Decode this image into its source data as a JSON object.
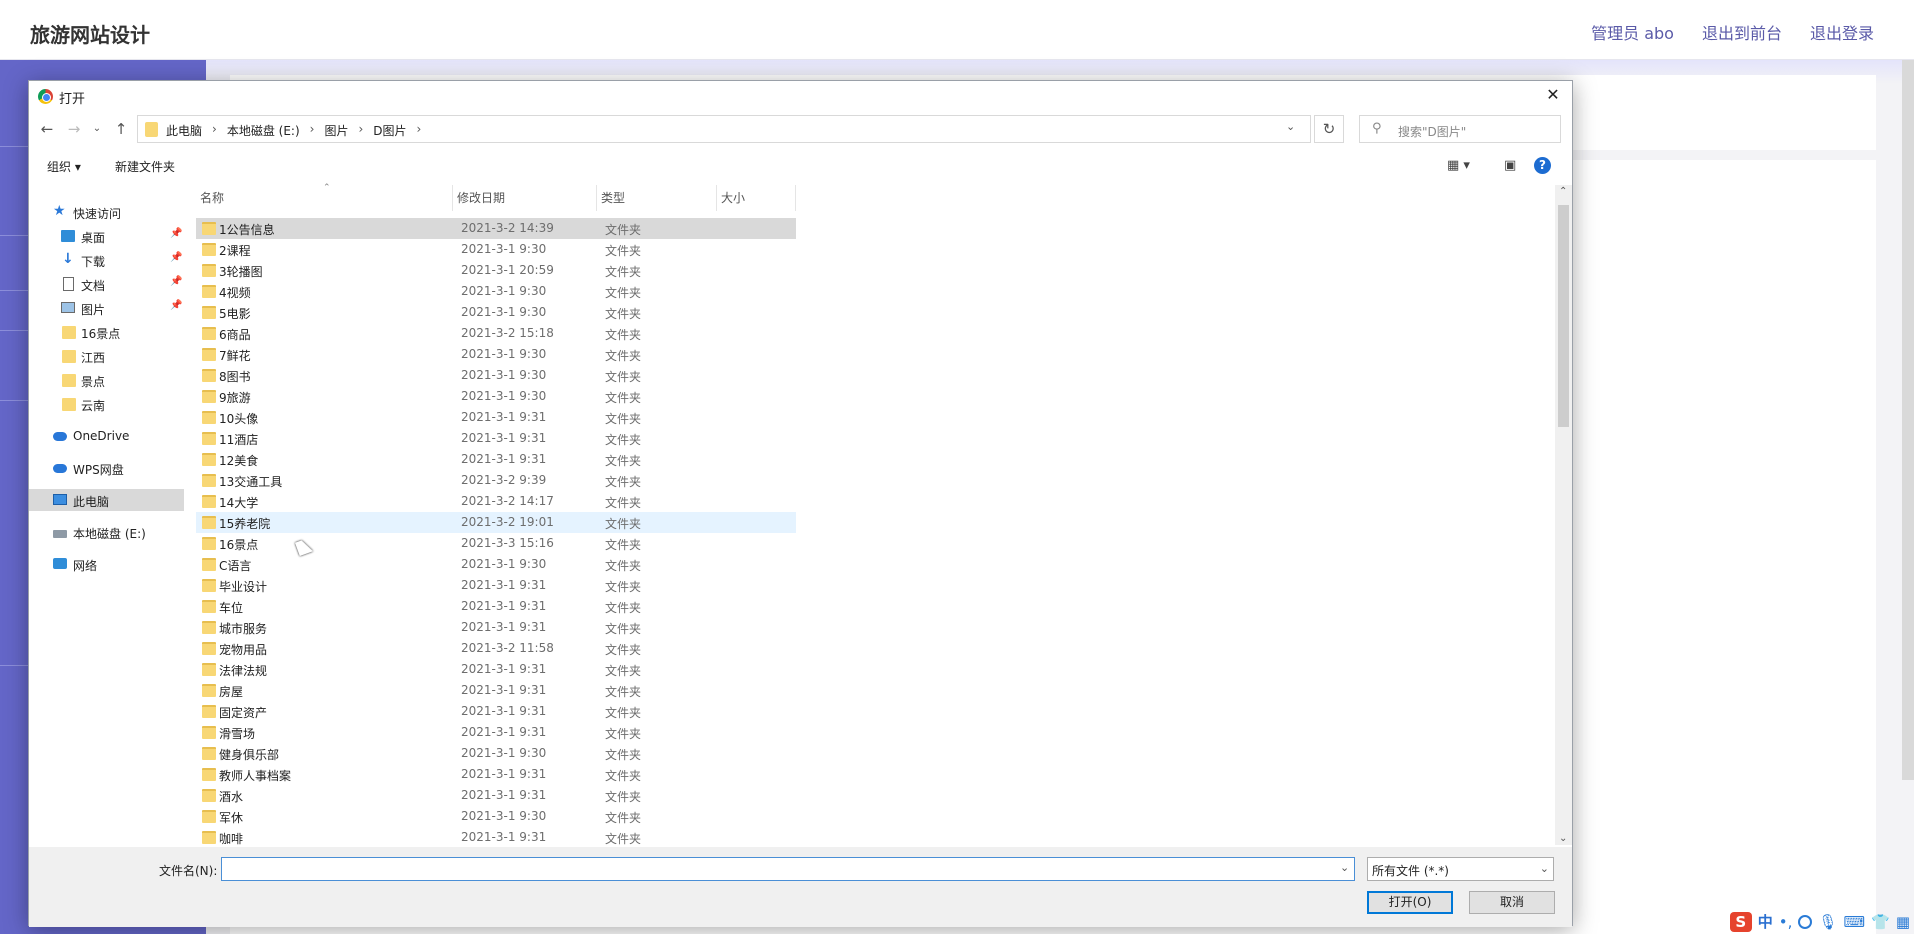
{
  "site": {
    "title": "旅游网站设计",
    "links": [
      "管理员 abo",
      "退出到前台",
      "退出登录"
    ]
  },
  "dialog": {
    "title": "打开",
    "close": "✕",
    "breadcrumbs": [
      "此电脑",
      "本地磁盘 (E:)",
      "图片",
      "D图片"
    ],
    "search_placeholder": "搜索\"D图片\"",
    "toolbar": {
      "organize": "组织 ▾",
      "new_folder": "新建文件夹"
    },
    "nav_pane": [
      {
        "label": "快速访问",
        "icon": "star-icon"
      },
      {
        "label": "桌面",
        "icon": "desktop-icon",
        "pinned": true
      },
      {
        "label": "下载",
        "icon": "download-icon",
        "pinned": true
      },
      {
        "label": "文档",
        "icon": "document-icon",
        "pinned": true
      },
      {
        "label": "图片",
        "icon": "pictures-icon",
        "pinned": true
      },
      {
        "label": "16景点",
        "icon": "folder-icon"
      },
      {
        "label": "江西",
        "icon": "folder-icon"
      },
      {
        "label": "景点",
        "icon": "folder-icon"
      },
      {
        "label": "云南",
        "icon": "folder-icon"
      },
      {
        "label": "OneDrive",
        "icon": "cloud-icon"
      },
      {
        "label": "WPS网盘",
        "icon": "cloud-icon"
      },
      {
        "label": "此电脑",
        "icon": "pc-icon",
        "selected": true
      },
      {
        "label": "本地磁盘 (E:)",
        "icon": "disk-icon"
      },
      {
        "label": "网络",
        "icon": "network-icon"
      }
    ],
    "columns": [
      "名称",
      "修改日期",
      "类型",
      "大小"
    ],
    "files": [
      {
        "name": "1公告信息",
        "date": "2021-3-2 14:39",
        "type": "文件夹"
      },
      {
        "name": "2课程",
        "date": "2021-3-1 9:30",
        "type": "文件夹"
      },
      {
        "name": "3轮播图",
        "date": "2021-3-1 20:59",
        "type": "文件夹"
      },
      {
        "name": "4视频",
        "date": "2021-3-1 9:30",
        "type": "文件夹"
      },
      {
        "name": "5电影",
        "date": "2021-3-1 9:30",
        "type": "文件夹"
      },
      {
        "name": "6商品",
        "date": "2021-3-2 15:18",
        "type": "文件夹"
      },
      {
        "name": "7鲜花",
        "date": "2021-3-1 9:30",
        "type": "文件夹"
      },
      {
        "name": "8图书",
        "date": "2021-3-1 9:30",
        "type": "文件夹"
      },
      {
        "name": "9旅游",
        "date": "2021-3-1 9:30",
        "type": "文件夹"
      },
      {
        "name": "10头像",
        "date": "2021-3-1 9:31",
        "type": "文件夹"
      },
      {
        "name": "11酒店",
        "date": "2021-3-1 9:31",
        "type": "文件夹"
      },
      {
        "name": "12美食",
        "date": "2021-3-1 9:31",
        "type": "文件夹"
      },
      {
        "name": "13交通工具",
        "date": "2021-3-2 9:39",
        "type": "文件夹"
      },
      {
        "name": "14大学",
        "date": "2021-3-2 14:17",
        "type": "文件夹"
      },
      {
        "name": "15养老院",
        "date": "2021-3-2 19:01",
        "type": "文件夹"
      },
      {
        "name": "16景点",
        "date": "2021-3-3 15:16",
        "type": "文件夹"
      },
      {
        "name": "C语言",
        "date": "2021-3-1 9:30",
        "type": "文件夹"
      },
      {
        "name": "毕业设计",
        "date": "2021-3-1 9:31",
        "type": "文件夹"
      },
      {
        "name": "车位",
        "date": "2021-3-1 9:31",
        "type": "文件夹"
      },
      {
        "name": "城市服务",
        "date": "2021-3-1 9:31",
        "type": "文件夹"
      },
      {
        "name": "宠物用品",
        "date": "2021-3-2 11:58",
        "type": "文件夹"
      },
      {
        "name": "法律法规",
        "date": "2021-3-1 9:31",
        "type": "文件夹"
      },
      {
        "name": "房屋",
        "date": "2021-3-1 9:31",
        "type": "文件夹"
      },
      {
        "name": "固定资产",
        "date": "2021-3-1 9:31",
        "type": "文件夹"
      },
      {
        "name": "滑雪场",
        "date": "2021-3-1 9:31",
        "type": "文件夹"
      },
      {
        "name": "健身俱乐部",
        "date": "2021-3-1 9:30",
        "type": "文件夹"
      },
      {
        "name": "教师人事档案",
        "date": "2021-3-1 9:31",
        "type": "文件夹"
      },
      {
        "name": "酒水",
        "date": "2021-3-1 9:31",
        "type": "文件夹"
      },
      {
        "name": "军休",
        "date": "2021-3-1 9:30",
        "type": "文件夹"
      },
      {
        "name": "咖啡",
        "date": "2021-3-1 9:31",
        "type": "文件夹"
      }
    ],
    "selected_row": 0,
    "hover_row": 14,
    "filename_label": "文件名(N):",
    "filename_value": "",
    "filter": "所有文件 (*.*)",
    "open_button": "打开(O)",
    "cancel_button": "取消"
  },
  "ime": {
    "logo": "S",
    "mode": "中"
  }
}
